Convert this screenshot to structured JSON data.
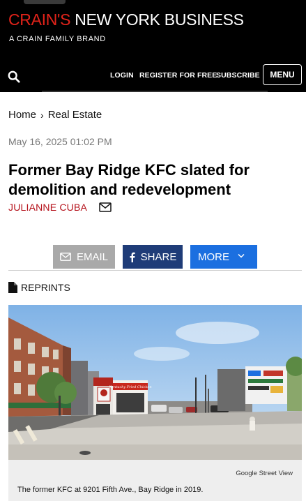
{
  "header": {
    "brand_red": "CRAIN'S",
    "brand_white": "NEW YORK BUSINESS",
    "brand_tagline": "A CRAIN FAMILY BRAND",
    "nav": {
      "login": "LOGIN",
      "register": "REGISTER FOR FREE",
      "subscribe": "SUBSCRIBE"
    },
    "menu_label": "MENU",
    "brand_color": "#e2231a"
  },
  "breadcrumb": {
    "home": "Home",
    "separator": "›",
    "section": "Real Estate"
  },
  "article": {
    "timestamp": "May 16, 2025 01:02 PM",
    "headline": "Former Bay Ridge KFC slated for demolition and redevelopment",
    "author": "JULIANNE CUBA",
    "author_color": "#b5121b"
  },
  "share": {
    "email_label": "EMAIL",
    "share_label": "SHARE",
    "more_label": "MORE"
  },
  "reprints_label": "REPRINTS",
  "image": {
    "credit": "Google Street View",
    "caption": "The former KFC at 9201 Fifth Ave., Bay Ridge in 2019.",
    "storefront_sign": "Kentucky Fried Chicken"
  }
}
